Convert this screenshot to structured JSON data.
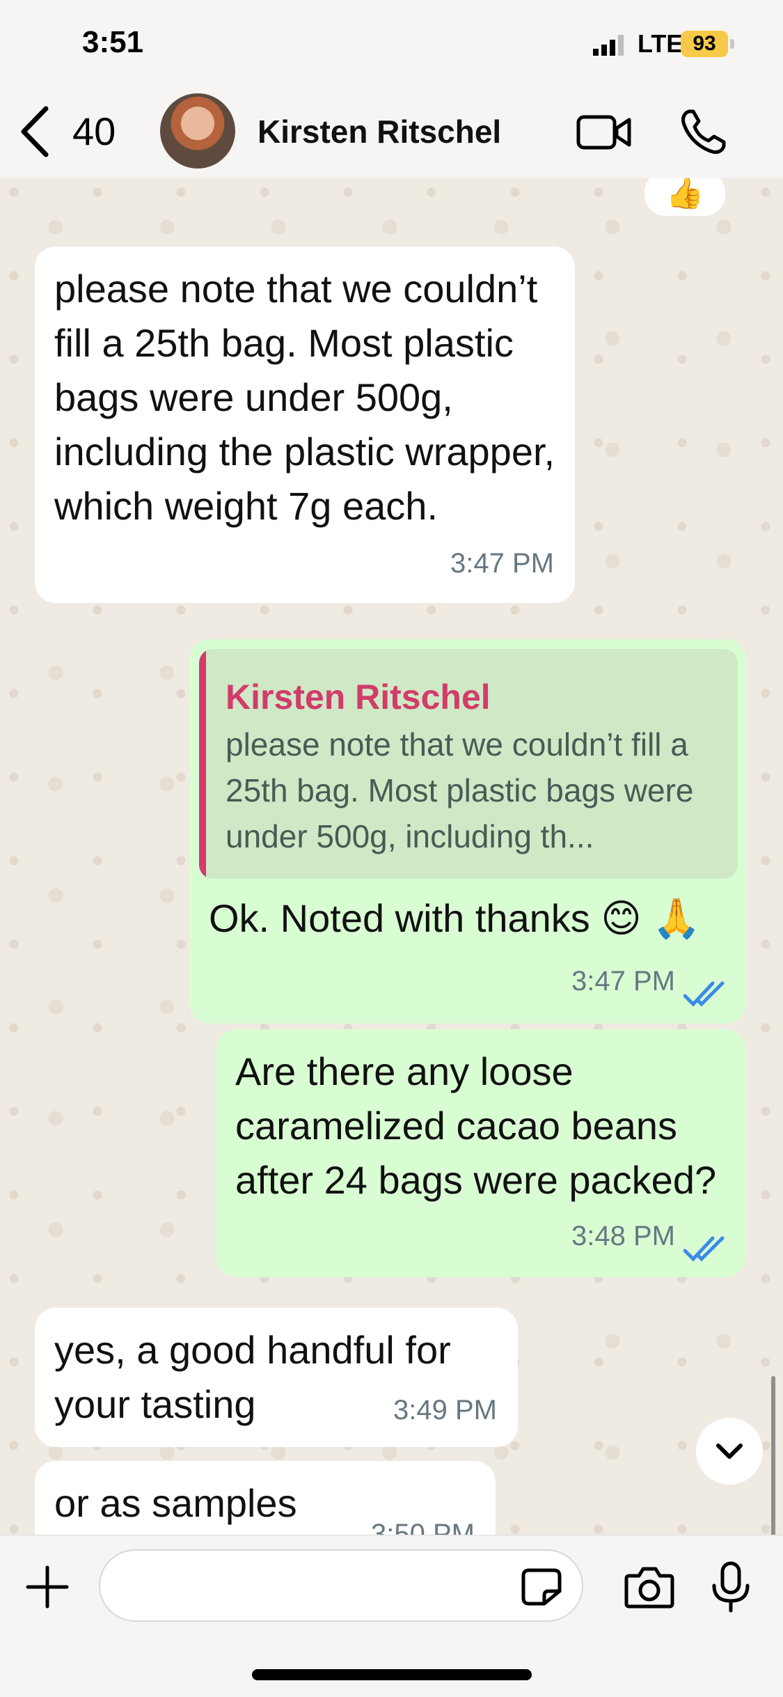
{
  "status_bar": {
    "time": "3:51",
    "network": "LTE",
    "battery": "93"
  },
  "header": {
    "back_count": "40",
    "contact_name": "Kirsten Ritschel"
  },
  "messages": [
    {
      "reaction": "👍"
    },
    {
      "text": "please note that we couldn’t fill a 25th bag. Most plastic bags were under 500g, including the plastic wrapper, which weight 7g each.",
      "time": "3:47 PM"
    },
    {
      "quote_name": "Kirsten Ritschel",
      "quote_text": "please note that we couldn’t fill a 25th bag. Most plastic bags were under 500g, including th...",
      "text": "Ok. Noted with thanks 😊 🙏",
      "time": "3:47 PM"
    },
    {
      "text": "Are there any loose caramelized cacao beans after 24 bags were packed?",
      "time": "3:48 PM"
    },
    {
      "text": "yes, a good handful for your tasting",
      "time": "3:49 PM"
    },
    {
      "text": "or as samples",
      "time": "3:50 PM"
    }
  ],
  "input": {
    "value": ""
  },
  "colors": {
    "outgoing": "#d9fdd3",
    "incoming": "#ffffff",
    "accent": "#d23b6a",
    "read_ticks": "#3b8ae6"
  }
}
